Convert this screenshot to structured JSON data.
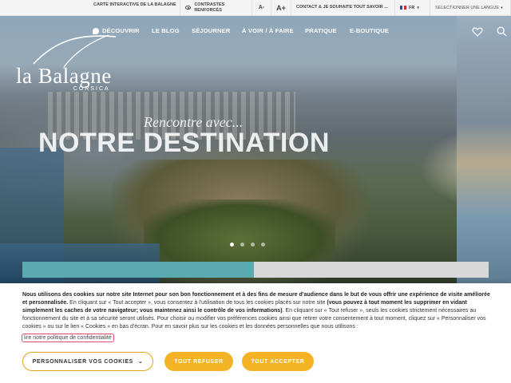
{
  "topbar": {
    "map_label": "CARTE INTERACTIVE DE LA BALAGNE",
    "contrast_label": "CONTRASTES RENFORCÉS",
    "font_decrease": "A-",
    "font_increase": "A+",
    "contact_label": "CONTACT & JE SOUHAITE TOUT SAVOIR ...",
    "lang_code": "FR",
    "lang_select": "SÉLECTIONNER UNE LANGUE"
  },
  "logo": {
    "name": "la Balagne",
    "sub": "CORSICA"
  },
  "nav": {
    "items": [
      "DÉCOUVRIR",
      "LE BLOG",
      "SÉJOURNER",
      "À VOIR / À FAIRE",
      "PRATIQUE",
      "E-BOUTIQUE"
    ]
  },
  "hero": {
    "tagline": "Rencontre avec...",
    "headline": "NOTRE DESTINATION"
  },
  "cookie": {
    "p1_bold": "Nous utilisons des cookies sur notre site Internet pour son bon fonctionnement et à des fins de mesure d'audience dans le but de vous offrir une expérience de visite améliorée et personnalisée.",
    "p2": " En cliquant sur « Tout accepter », vous consentez à l'utilisation de tous les cookies placés sur notre site ",
    "p3_bold": "(vous pouvez à tout moment les supprimer en vidant simplement les caches de votre navigateur; vous maintenez ainsi le contrôle de vos informations)",
    "p4": ". En cliquant sur « Tout refuser », seuls les cookies strictement nécessaires au fonctionnement du site et à sa sécurité seront utilisés. Pour choisir ou modifier vos préférences cookies ainsi que retirer votre consentement à tout moment, cliquez sur « Personnaliser vos cookies » ou sur le lien « Cookies » en bas d'écran. Pour en savoir plus sur les cookies et les données personnelles que nous utilisons :",
    "policy_link": "lire notre politique de confidentialité",
    "customize_btn": "PERSONNALISER VOS COOKIES",
    "refuse_btn": "TOUT REFUSER",
    "accept_btn": "TOUT ACCEPTER"
  },
  "colors": {
    "accent_yellow": "#f4b324",
    "teal": "#5aaab0",
    "focus_outline": "#e04b6a"
  },
  "icons": {
    "contrast": "eye-icon",
    "flag": "french-flag-icon",
    "favorites": "heart-icon",
    "search": "search-icon",
    "discover": "leaf-icon",
    "dropdown": "chevron-down-icon"
  }
}
